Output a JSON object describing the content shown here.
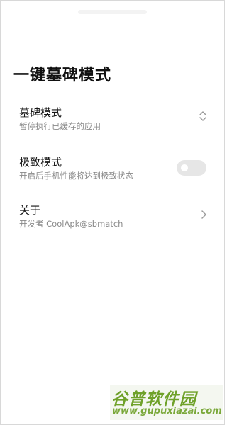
{
  "page": {
    "title": "一键墓碑模式"
  },
  "settings": {
    "items": [
      {
        "title": "墓碑模式",
        "subtitle": "暂停执行已缓存的应用",
        "control": "updown-icon"
      },
      {
        "title": "极致模式",
        "subtitle": "开启后手机性能将达到极致状态",
        "control": "toggle",
        "enabled": false
      },
      {
        "title": "关于",
        "subtitle": "开发者 CoolApk@sbmatch",
        "control": "chevron-right-icon"
      }
    ]
  },
  "watermark": {
    "brand": "谷普软件园",
    "url": "www.gupuxiazai.com"
  },
  "colors": {
    "background": "#ffffff",
    "title": "#111111",
    "subtitle": "#8a8a8a",
    "toggle_off": "#e6e6e6",
    "icon": "#9a9a9a",
    "watermark_green": "#6fa12a"
  }
}
